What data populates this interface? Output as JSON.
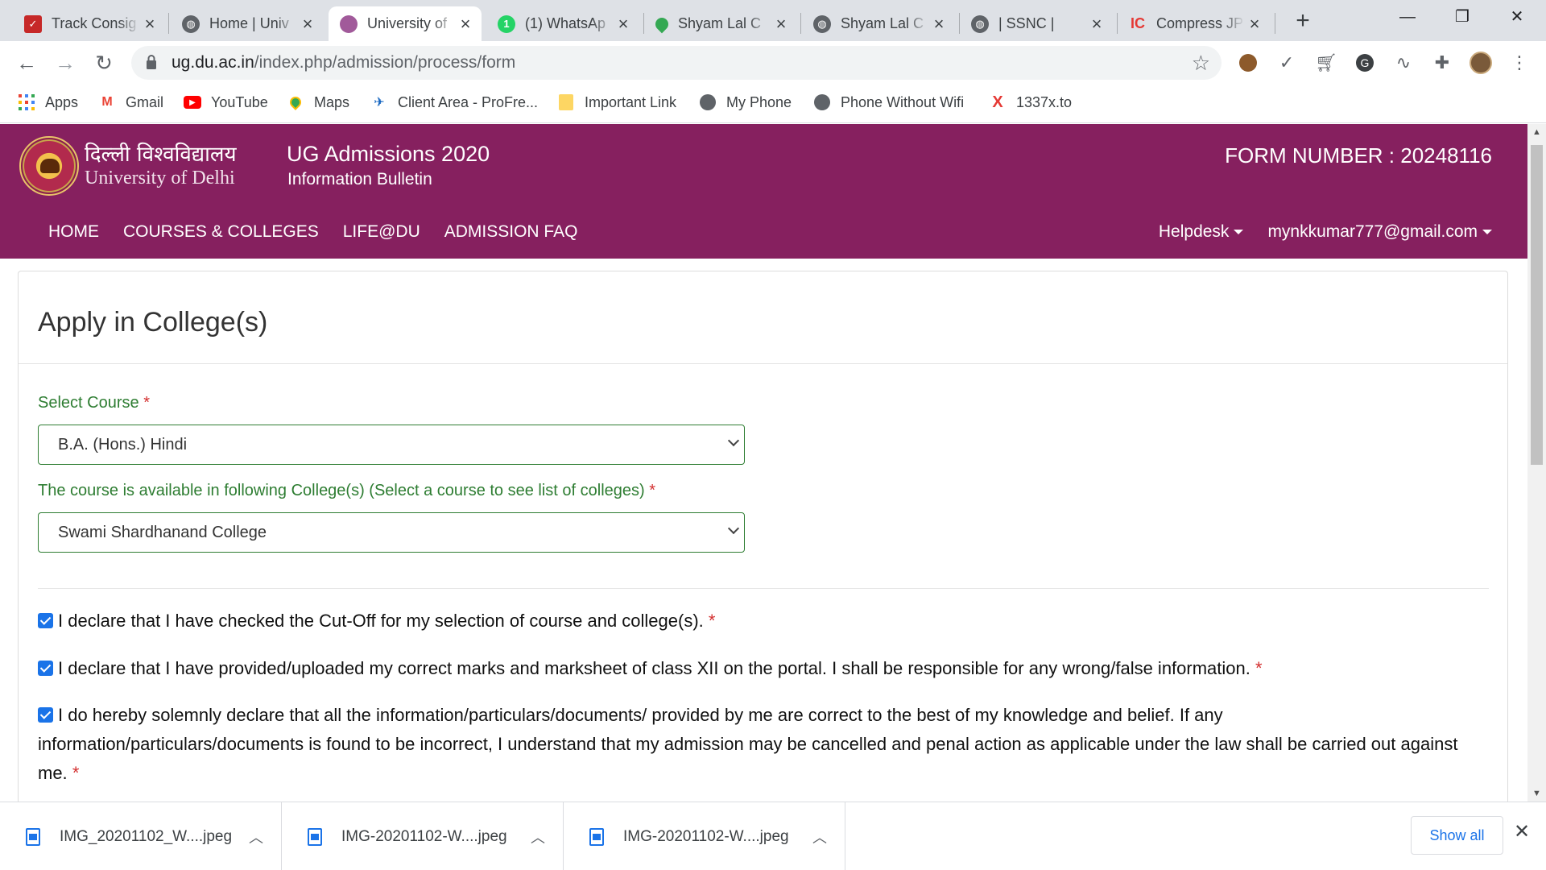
{
  "browser": {
    "tabs": [
      {
        "title": "Track Consig",
        "icon": "check-icon",
        "color": "#c62828"
      },
      {
        "title": "Home | Univ",
        "icon": "globe-icon",
        "color": "#5f6368"
      },
      {
        "title": "University of",
        "icon": "du-logo-icon",
        "color": "#86205f"
      },
      {
        "title": "(1) WhatsAp",
        "icon": "whatsapp-icon",
        "color": "#25d366"
      },
      {
        "title": "Shyam Lal C",
        "icon": "maps-pin-icon",
        "color": "#34a853"
      },
      {
        "title": "Shyam Lal C",
        "icon": "globe-icon",
        "color": "#5f6368"
      },
      {
        "title": "| SSNC |",
        "icon": "globe-icon",
        "color": "#5f6368"
      },
      {
        "title": "Compress JP",
        "icon": "ic-icon",
        "color": "#e53935"
      }
    ],
    "url_domain": "ug.du.ac.in",
    "url_path": "/index.php/admission/process/form",
    "bookmarks": [
      {
        "label": "Apps"
      },
      {
        "label": "Gmail"
      },
      {
        "label": "YouTube"
      },
      {
        "label": "Maps"
      },
      {
        "label": "Client Area - ProFre..."
      },
      {
        "label": "Important Link"
      },
      {
        "label": "My Phone"
      },
      {
        "label": "Phone Without Wifi"
      },
      {
        "label": "1337x.to"
      }
    ]
  },
  "site": {
    "hindi_name": "दिल्ली विश्वविद्यालय",
    "english_name": "University of Delhi",
    "title": "UG Admissions 2020",
    "subtitle": "Information Bulletin",
    "form_number": "FORM NUMBER : 20248116",
    "nav": [
      "HOME",
      "COURSES & COLLEGES",
      "LIFE@DU",
      "ADMISSION FAQ"
    ],
    "helpdesk": "Helpdesk",
    "user_email": "mynkkumar777@gmail.com"
  },
  "form": {
    "heading": "Apply in College(s)",
    "course_label": "Select Course",
    "course_value": "B.A. (Hons.) Hindi",
    "college_label": "The course is available in following College(s) (Select a course to see list of colleges)",
    "college_value": "Swami Shardhanand College",
    "required_mark": "*",
    "declarations": [
      "I declare that I have checked the Cut-Off for my selection of course and college(s).",
      "I declare that I have provided/uploaded my correct marks and marksheet of class XII on the portal. I shall be responsible for any wrong/false information.",
      "I do hereby solemnly declare that all the information/particulars/documents/ provided by me are correct to the best of my knowledge and belief. If any information/particulars/documents is found to be incorrect, I understand that my admission may be cancelled and penal action as applicable under the law shall be carried out against me."
    ]
  },
  "downloads": {
    "files": [
      "IMG_20201102_W....jpeg",
      "IMG-20201102-W....jpeg",
      "IMG-20201102-W....jpeg"
    ],
    "show_all": "Show all"
  }
}
